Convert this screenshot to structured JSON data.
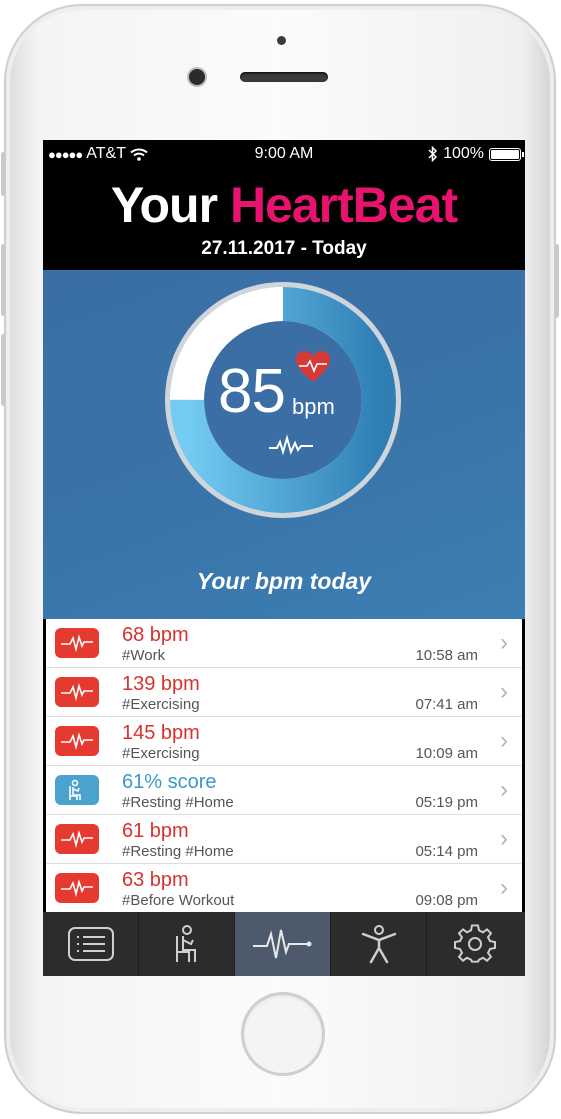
{
  "status_bar": {
    "signal_dots": "●●●●●",
    "carrier": "AT&T",
    "time": "9:00 AM",
    "battery_percent": "100%"
  },
  "header": {
    "title_part1": "Your",
    "title_part2": "HeartBeat",
    "date_range": "27.11.2017 - Today"
  },
  "gauge": {
    "value": "85",
    "unit": "bpm",
    "fill_fraction": 0.75,
    "caption": "Your bpm today"
  },
  "entries": [
    {
      "type": "pulse",
      "title": "68 bpm",
      "tags": "#Work",
      "time": "10:58 am"
    },
    {
      "type": "pulse",
      "title": "139 bpm",
      "tags": "#Exercising",
      "time": "07:41 am"
    },
    {
      "type": "pulse",
      "title": "145 bpm",
      "tags": "#Exercising",
      "time": "10:09 am"
    },
    {
      "type": "rest",
      "title": "61% score",
      "tags": "#Resting  #Home",
      "time": "05:19 pm"
    },
    {
      "type": "pulse",
      "title": "61 bpm",
      "tags": "#Resting  #Home",
      "time": "05:14 pm"
    },
    {
      "type": "pulse",
      "title": "63 bpm",
      "tags": "#Before Workout",
      "time": "09:08 pm"
    }
  ],
  "tabs": [
    "list-icon",
    "sitting-icon",
    "heartbeat-icon",
    "activity-icon",
    "settings-icon"
  ],
  "active_tab": "heartbeat-icon",
  "colors": {
    "accent_pink": "#e8126f",
    "hero_blue": "#3a6ea5",
    "entry_red": "#e53a2f",
    "entry_blue": "#4aa3cf"
  }
}
